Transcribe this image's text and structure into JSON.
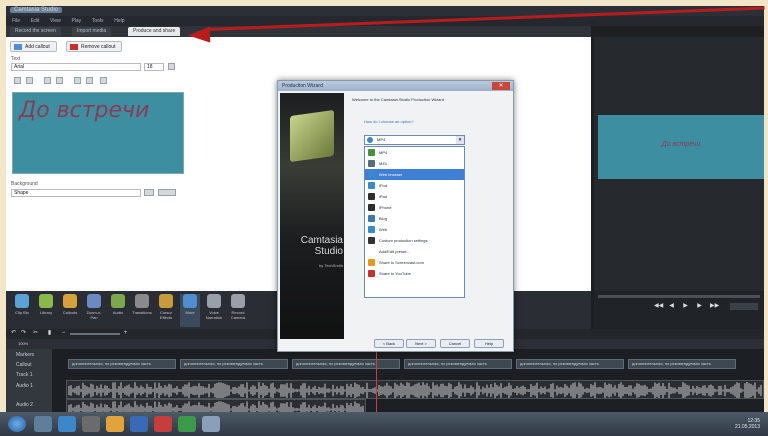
{
  "window": {
    "title": "Camtasia Studio"
  },
  "menu": {
    "items": [
      "File",
      "Edit",
      "View",
      "Play",
      "Tools",
      "Help"
    ]
  },
  "clip_tabs": [
    {
      "label": "Record the screen"
    },
    {
      "label": "Import media"
    },
    {
      "label": "Produce and share"
    }
  ],
  "callout_panel": {
    "add_callout": "Add callout",
    "remove_callout": "Remove callout",
    "text_label": "Text",
    "font_value": "Arial",
    "font_size": "18",
    "preview_caption": "До встречи",
    "background_label": "Background",
    "background_value": "Shape"
  },
  "dialog": {
    "title": "Production Wizard",
    "close": "✕",
    "welcome": "Welcome to the Camtasia Studio Production Wizard",
    "link": "How do I choose an option?",
    "combo_value": "MP4",
    "options": [
      {
        "label": "MP4",
        "icon_color": "#4a8f3a",
        "selected": false
      },
      {
        "label": "M4V",
        "icon_color": "#5a6b7a",
        "selected": false
      },
      {
        "label": "Web browser",
        "icon_color": "#3a8acb",
        "selected": true
      },
      {
        "label": "iPod",
        "icon_color": "#3a8acb",
        "selected": false
      },
      {
        "label": "iPad",
        "icon_color": "#2e2e2e",
        "selected": false
      },
      {
        "label": "iPhone",
        "icon_color": "#2e2e2e",
        "selected": false
      },
      {
        "label": "Blog",
        "icon_color": "#3a7ab0",
        "selected": false
      },
      {
        "label": "Web",
        "icon_color": "#3a8acb",
        "selected": false
      },
      {
        "label": "Custom production settings",
        "icon_color": "#333333",
        "selected": false
      },
      {
        "label": "Add/Edit preset...",
        "icon_color": "#ffffff",
        "selected": false
      },
      {
        "label": "Share to Screencast.com",
        "icon_color": "#e69a1a",
        "selected": false
      },
      {
        "label": "Share to YouTube",
        "icon_color": "#c8302a",
        "selected": false
      }
    ],
    "brand_name": "Camtasia Studio",
    "brand_sub": "by TechSmith",
    "buttons": {
      "back": "< Back",
      "next": "Next >",
      "cancel": "Cancel",
      "help": "Help"
    }
  },
  "preview": {
    "caption": "До встречи"
  },
  "tasks": [
    {
      "label": "Clip Bin",
      "icon": "clip-bin-icon",
      "color": "#5aa3d6"
    },
    {
      "label": "Library",
      "icon": "library-icon",
      "color": "#8ab84a"
    },
    {
      "label": "Callouts",
      "icon": "callouts-icon",
      "color": "#d6a03a"
    },
    {
      "label": "Zoom-n-Pan",
      "icon": "zoom-icon",
      "color": "#6b8ac2"
    },
    {
      "label": "Audio",
      "icon": "audio-icon",
      "color": "#7aa84a"
    },
    {
      "label": "Transitions",
      "icon": "transitions-icon",
      "color": "#8a8a8a"
    },
    {
      "label": "Cursor Effects",
      "icon": "cursor-icon",
      "color": "#c89a3a"
    },
    {
      "label": "More",
      "icon": "more-icon",
      "color": "#4f8fd0"
    },
    {
      "label": "Voice Narration",
      "icon": "voice-icon",
      "color": "#9aa0a8"
    },
    {
      "label": "Record Camera",
      "icon": "camera-icon",
      "color": "#9aa0a8"
    }
  ],
  "timeline": {
    "tracks": [
      {
        "label": "Markers"
      },
      {
        "label": "Callout"
      },
      {
        "label": "Track 1"
      },
      {
        "label": "Audio 1"
      },
      {
        "label": "Audio 2"
      }
    ],
    "callout_clip": "дополнительная, но рекомендуемая часть",
    "zoom": "100%"
  },
  "taskbar": {
    "time": "12:35",
    "date": "21.05.2013"
  },
  "annotation": {
    "color": "#b81c1c"
  }
}
